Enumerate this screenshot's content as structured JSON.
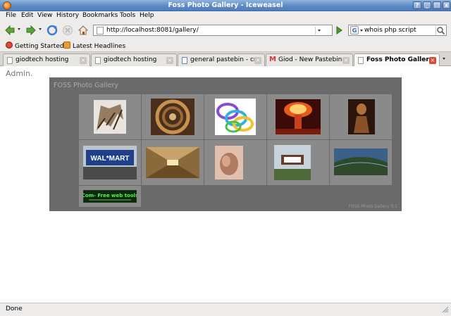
{
  "window": {
    "title": "Foss Photo Gallery - Iceweasel",
    "buttons": [
      "?",
      "_",
      "□",
      "x"
    ]
  },
  "menu": {
    "items": [
      "File",
      "Edit",
      "View",
      "History",
      "Bookmarks",
      "Tools",
      "Help"
    ]
  },
  "navigation": {
    "url": "http://localhost:8081/gallery/",
    "search_engine_icon": "google-icon",
    "search_query": "whois php script"
  },
  "bookmarks_toolbar": {
    "items": [
      {
        "label": "Getting Started",
        "icon": "getting-started-icon"
      },
      {
        "label": "Latest Headlines",
        "icon": "rss-icon"
      }
    ]
  },
  "tabs": [
    {
      "label": "giodtech hosting",
      "icon": "page-icon"
    },
    {
      "label": "giodtech hosting",
      "icon": "page-icon"
    },
    {
      "label": "general pastebin - cr...",
      "icon": "pastebin-icon"
    },
    {
      "label": "Giod - New Pastebin ...",
      "icon": "gmail-icon"
    },
    {
      "label": "Foss Photo Gallery",
      "icon": "page-icon",
      "active": true
    }
  ],
  "page": {
    "admin_link": "Admin.",
    "gallery_title": "FOSS Photo Gallery",
    "gallery_footer": "FOSS Photo Gallery 0.1",
    "accent_bg": "#6a6a6a",
    "cell_bg": "#8a8a8a",
    "thumbnails": [
      {
        "name": "escher-stairs-thumbnail"
      },
      {
        "name": "spiral-staircase-thumbnail"
      },
      {
        "name": "slinky-toy-thumbnail"
      },
      {
        "name": "mushroom-cloud-thumbnail"
      },
      {
        "name": "statue-thumbnail"
      },
      {
        "name": "walmart-store-thumbnail",
        "text": "WAL*MART"
      },
      {
        "name": "tunnel-thumbnail"
      },
      {
        "name": "hand-thumbnail"
      },
      {
        "name": "street-sign-thumbnail"
      },
      {
        "name": "panorama-thumbnail"
      },
      {
        "name": "web-tools-banner-thumbnail",
        "text": "Com- Free web tools"
      }
    ]
  },
  "status": {
    "text": "Done"
  }
}
